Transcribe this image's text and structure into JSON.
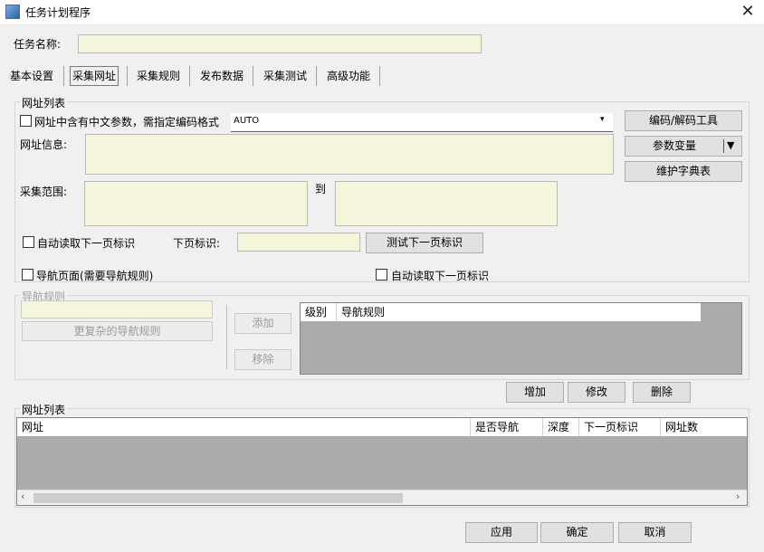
{
  "window": {
    "title": "任务计划程序",
    "close_glyph": "✕"
  },
  "task_name": {
    "label": "任务名称:",
    "value": ""
  },
  "tabs": [
    {
      "label": "基本设置"
    },
    {
      "label": "采集网址"
    },
    {
      "label": "采集规则"
    },
    {
      "label": "发布数据"
    },
    {
      "label": "采集测试"
    },
    {
      "label": "高级功能"
    }
  ],
  "active_tab": "采集网址",
  "url_list_group": {
    "title": "网址列表",
    "chinese_param_checkbox": "网址中含有中文参数，需指定编码格式",
    "encoding_value": "AUTO",
    "url_info_label": "网址信息:",
    "range_label": "采集范围:",
    "to_label": "到",
    "encode_tool_button": "编码/解码工具",
    "param_var_button": "参数变量",
    "dict_button": "维护字典表",
    "auto_next_checkbox": "自动读取下一页标识",
    "next_mark_label": "下页标识:",
    "test_next_button": "测试下一页标识",
    "nav_page_checkbox": "导航页面(需要导航规则)",
    "auto_next_checkbox_2": "自动读取下一页标识"
  },
  "nav_rules_group": {
    "title": "导航规则",
    "complex_button": "更复杂的导航规则",
    "add_button": "添加",
    "remove_button": "移除",
    "columns": [
      "级别",
      "导航规则"
    ]
  },
  "list_actions": {
    "add": "增加",
    "edit": "修改",
    "delete": "删除"
  },
  "url_table": {
    "title": "网址列表",
    "columns": [
      "网址",
      "是否导航",
      "深度",
      "下一页标识",
      "网址数"
    ]
  },
  "footer": {
    "apply": "应用",
    "ok": "确定",
    "cancel": "取消"
  },
  "icons": {
    "dropdown": "chevron-down-icon",
    "scroll_left": "chevron-left-icon",
    "scroll_right": "chevron-right-icon"
  }
}
